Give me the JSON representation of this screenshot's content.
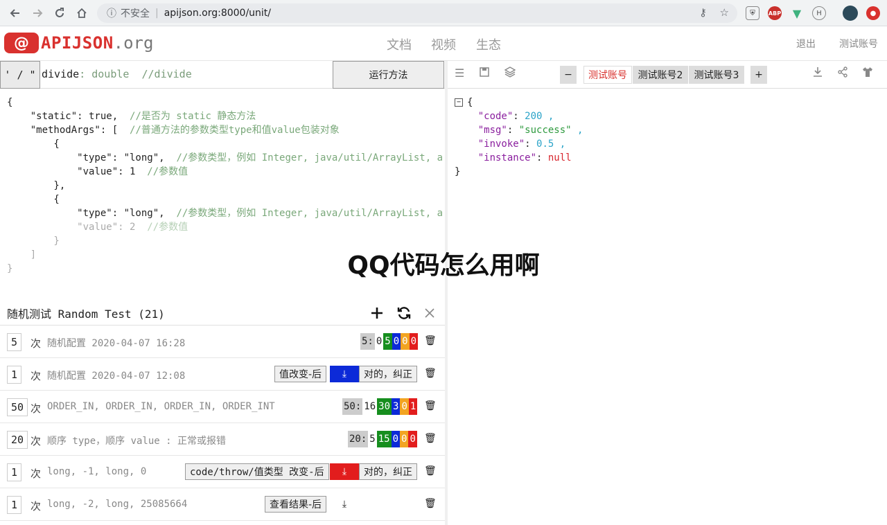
{
  "browser": {
    "security_text": "不安全",
    "url": "apijson.org:8000/unit/",
    "icons": [
      "back-icon",
      "forward-icon",
      "reload-icon",
      "home-icon",
      "info-icon",
      "key-icon",
      "star-icon"
    ],
    "ext_abp": "ABP"
  },
  "header": {
    "logo_at": "@",
    "logo_name": "APIJSON",
    "logo_tld": ".org",
    "nav": [
      "文档",
      "视频",
      "生态"
    ],
    "logout": "退出",
    "test_account": "测试账号"
  },
  "method": {
    "toggle": "' / \"",
    "name": "divide",
    "type": ": double",
    "comment": "//divide",
    "run_label": "运行方法"
  },
  "code": {
    "l1": "{",
    "l2_key": "    \"static\": true,  ",
    "l2_comment": "//是否为 static 静态方法",
    "l3_key": "    \"methodArgs\": [  ",
    "l3_comment": "//普通方法的参数类型type和值value包装对象",
    "l4": "        {",
    "l5_key": "            \"type\": \"long\",  ",
    "l5_comment": "//参数类型，例如 Integer, java/util/ArrayList, a",
    "l6_key": "            \"value\": 1  ",
    "l6_comment": "//参数值",
    "l7": "        },",
    "l8": "        {",
    "l9_key": "            \"type\": \"long\",  ",
    "l9_comment": "//参数类型，例如 Integer, java/util/ArrayList, a",
    "l10_key": "            \"value\": 2  ",
    "l10_comment": "//参数值",
    "l11": "        }",
    "l12": "    ]",
    "l13": "}"
  },
  "random_test": {
    "title": "随机测试 Random Test (21)",
    "times_unit": "次",
    "rows": [
      {
        "count": "5",
        "desc": "随机配置 2020-04-07 16:28",
        "stat": {
          "label": "5:",
          "n": "0",
          "g": "5",
          "b": "0",
          "o": "0",
          "r": "0"
        }
      },
      {
        "count": "1",
        "desc": "随机配置 2020-04-07 12:08",
        "btn": "值改变-后",
        "confirm": "对的，纠正"
      },
      {
        "count": "50",
        "desc": "ORDER_IN, ORDER_IN, ORDER_IN, ORDER_INT",
        "stat": {
          "label": "50:",
          "n": "16",
          "g": "30",
          "b": "3",
          "o": "0",
          "r": "1"
        }
      },
      {
        "count": "20",
        "desc": "顺序 type，顺序 value : 正常或报错",
        "stat": {
          "label": "20:",
          "n": "5",
          "g": "15",
          "b": "0",
          "o": "0",
          "r": "0"
        }
      },
      {
        "count": "1",
        "desc": "long, -1, long, 0",
        "btn": "code/throw/值类型 改变-后",
        "confirm": "对的，纠正"
      },
      {
        "count": "1",
        "desc": "long, -2, long, 25085664",
        "btn": "查看结果-后"
      }
    ]
  },
  "accounts": {
    "minus": "−",
    "plus": "+",
    "items": [
      "测试账号",
      "测试账号2",
      "测试账号3"
    ]
  },
  "result": {
    "open": "{",
    "code_key": "\"code\"",
    "code_val": "200",
    "msg_key": "\"msg\"",
    "msg_val": "\"success\"",
    "invoke_key": "\"invoke\"",
    "invoke_val": "0.5",
    "instance_key": "\"instance\"",
    "instance_val": "null",
    "close": "}"
  },
  "overlay_text": "QQ代码怎么用啊",
  "colors": {
    "accent": "#d9312e",
    "green": "#168e1e",
    "blue": "#0c2ad8",
    "orange": "#f2a422",
    "red": "#e21d1d"
  }
}
